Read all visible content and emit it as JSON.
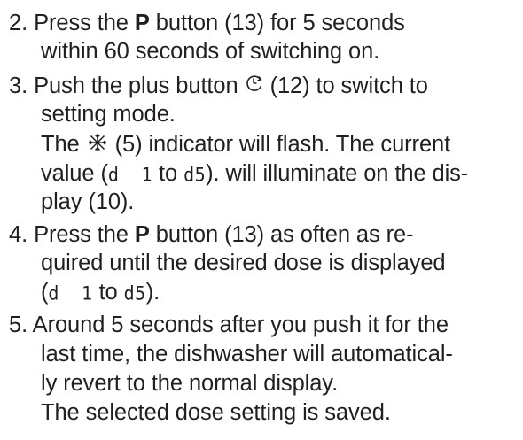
{
  "steps": [
    {
      "number": "2.",
      "lines": [
        {
          "pre": "Press the ",
          "bold": "P",
          "post": " button (13) for 5 seconds"
        },
        {
          "text": "within 60 seconds of switching on."
        }
      ]
    },
    {
      "number": "3.",
      "lines": [
        {
          "pre": "Push the plus button ",
          "post": " (12) to switch to",
          "icon": "clock-plus-icon"
        },
        {
          "text": "setting mode."
        },
        {
          "pre": "The ",
          "post": " (5) indicator will flash. The current",
          "icon": "snowflake-sun-icon"
        },
        {
          "pre": "value (",
          "seg1": "d  1",
          "mid": " to ",
          "seg2": "d5",
          "post": "). will illuminate on the dis-"
        },
        {
          "text": "play (10)."
        }
      ]
    },
    {
      "number": "4.",
      "lines": [
        {
          "pre": "Press the ",
          "bold": "P",
          "post": " button (13) as often as re-"
        },
        {
          "text": "quired until the desired dose is displayed"
        },
        {
          "pre": "(",
          "seg1": "d  1",
          "mid": " to ",
          "seg2": "d5",
          "post": ")."
        }
      ]
    },
    {
      "number": "5.",
      "lines": [
        {
          "text": "Around 5 seconds after you push it for the"
        },
        {
          "text": "last time, the dishwasher will automatical-"
        },
        {
          "text": "ly revert to the normal display."
        },
        {
          "text": "The selected dose setting is saved."
        }
      ]
    }
  ]
}
